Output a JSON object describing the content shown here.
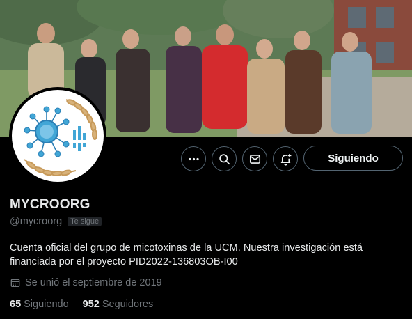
{
  "profile": {
    "display_name": "MYCROORG",
    "handle": "@mycroorg",
    "follows_you_badge": "Te sigue",
    "bio_line1": "Cuenta oficial del grupo de micotoxinas de la UCM. Nuestra investigación está",
    "bio_line2": "financiada por el proyecto PID2022-136803OB-I00",
    "joined": "Se unió el septiembre de 2019",
    "following_count": "65",
    "following_label": "Siguiendo",
    "followers_count": "952",
    "followers_label": "Seguidores"
  },
  "actions": {
    "more_icon": "more-horizontal-icon",
    "search_icon": "search-icon",
    "message_icon": "envelope-icon",
    "notify_icon": "bell-plus-icon",
    "follow_label": "Siguiendo"
  },
  "colors": {
    "background": "#000000",
    "text_primary": "#e7e9ea",
    "text_secondary": "#71767b",
    "border": "#536471",
    "avatar_accent": "#41a6d6",
    "avatar_wheat": "#c79a5a"
  }
}
